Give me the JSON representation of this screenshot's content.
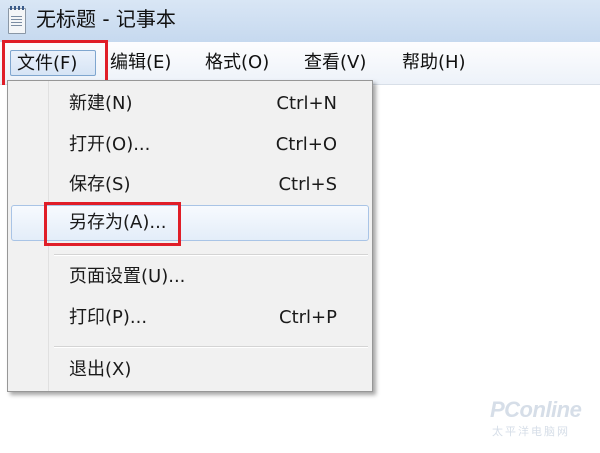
{
  "window": {
    "title": "无标题 - 记事本"
  },
  "menubar": {
    "items": [
      {
        "label": "文件(F)"
      },
      {
        "label": "编辑(E)"
      },
      {
        "label": "格式(O)"
      },
      {
        "label": "查看(V)"
      },
      {
        "label": "帮助(H)"
      }
    ]
  },
  "file_menu": {
    "items": [
      {
        "label": "新建(N)",
        "shortcut": "Ctrl+N"
      },
      {
        "label": "打开(O)...",
        "shortcut": "Ctrl+O"
      },
      {
        "label": "保存(S)",
        "shortcut": "Ctrl+S"
      },
      {
        "label": "另存为(A)...",
        "shortcut": ""
      },
      {
        "label": "页面设置(U)...",
        "shortcut": ""
      },
      {
        "label": "打印(P)...",
        "shortcut": "Ctrl+P"
      },
      {
        "label": "退出(X)",
        "shortcut": ""
      }
    ]
  },
  "watermark": {
    "logo": "PConline",
    "subtitle": "太平洋电脑网"
  },
  "colors": {
    "highlight_border": "#e01e28",
    "menu_hover": "#e3edf9"
  }
}
